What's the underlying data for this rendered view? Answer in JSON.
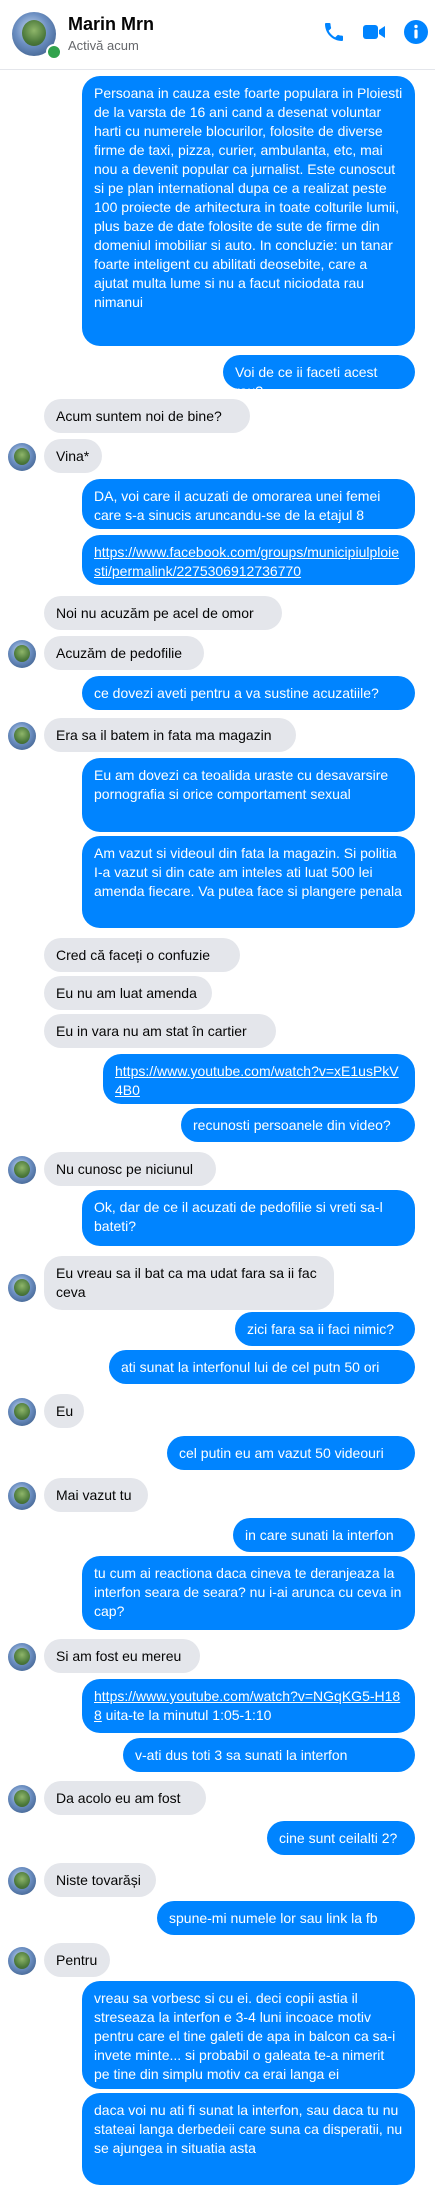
{
  "header": {
    "name": "Marin Mrn",
    "status": "Activă acum",
    "accent_color": "#0084ff",
    "icons": [
      "phone-icon",
      "video-camera-icon",
      "info-icon"
    ]
  },
  "messages": [
    {
      "dir": "out",
      "text": "Persoana in cauza este foarte populara in Ploiesti de la varsta de 16 ani cand a desenat voluntar harti cu numerele blocurilor, folosite de diverse firme de taxi, pizza, curier, ambulanta, etc, mai nou a devenit popular ca jurnalist. Este cunoscut si pe plan international dupa ce a realizat peste 100 proiecte de arhitectura in toate colturile lumii, plus baze de date folosite de sute de firme din domeniul imobiliar si auto. In concluzie: un tanar foarte inteligent cu abilitati deosebite, care a ajutat multa lume si nu a facut niciodata rau nimanui"
    },
    {
      "dir": "out",
      "text": "Voi de ce ii faceti acest rau?"
    },
    {
      "dir": "in",
      "text": "Acum suntem noi de  bine?"
    },
    {
      "dir": "in",
      "text": "Vina*"
    },
    {
      "dir": "out",
      "text": "DA, voi care il acuzati de omorarea unei femei care s-a sinucis aruncandu-se de la etajul 8"
    },
    {
      "dir": "out",
      "text": "https://www.facebook.com/groups/municipiulploiesti/permalink/2275306912736770"
    },
    {
      "dir": "in",
      "text": "Noi nu acuzăm pe acel de omor"
    },
    {
      "dir": "in",
      "text": "Acuzăm de pedofilie"
    },
    {
      "dir": "out",
      "text": "ce dovezi aveti pentru a va sustine acuzatiile?"
    },
    {
      "dir": "in",
      "text": "Era sa il batem in fata ma magazin"
    },
    {
      "dir": "out",
      "text": "Eu am dovezi ca teoalida uraste cu desavarsire pornografia si orice comportament sexual"
    },
    {
      "dir": "out",
      "text": "Am vazut si videoul din fata la magazin. Si politia I-a vazut si din cate am inteles ati luat 500 lei amenda fiecare. Va putea face si plangere penala"
    },
    {
      "dir": "in",
      "text": "Cred că faceți o confuzie"
    },
    {
      "dir": "in",
      "text": "Eu nu am luat amenda"
    },
    {
      "dir": "in",
      "text": "Eu in vara nu am stat în cartier"
    },
    {
      "dir": "out",
      "text": "https://www.youtube.com/watch?v=xE1usPkV4B0"
    },
    {
      "dir": "out",
      "text": "recunosti persoanele din video?"
    },
    {
      "dir": "in",
      "text": "Nu cunosc pe niciunul"
    },
    {
      "dir": "out",
      "text": "Ok, dar de ce il acuzati de pedofilie si vreti sa-l bateti?"
    },
    {
      "dir": "in",
      "text": "Eu vreau sa il bat ca ma udat fara sa ii fac ceva"
    },
    {
      "dir": "out",
      "text": "zici fara sa ii faci nimic?"
    },
    {
      "dir": "out",
      "text": "ati sunat la interfonul lui de cel putn 50 ori"
    },
    {
      "dir": "in",
      "text": "Eu"
    },
    {
      "dir": "out",
      "text": "cel putin eu am vazut 50 videouri"
    },
    {
      "dir": "in",
      "text": "Mai vazut tu"
    },
    {
      "dir": "out",
      "text": "in care sunati la interfon"
    },
    {
      "dir": "out",
      "text": "tu cum ai reactiona daca cineva te deranjeaza la interfon seara de seara? nu i-ai arunca cu ceva in cap?"
    },
    {
      "dir": "in",
      "text": "Si am fost eu mereu"
    },
    {
      "dir": "out",
      "link": "https://www.youtube.com/watch?v=NGqKG5-H188",
      "text": " uita-te la minutul 1:05-1:10"
    },
    {
      "dir": "out",
      "text": "v-ati dus toti 3 sa sunati la interfon"
    },
    {
      "dir": "in",
      "text": "Da  acolo eu am fost"
    },
    {
      "dir": "out",
      "text": "cine sunt ceilalti 2?"
    },
    {
      "dir": "in",
      "text": "Niste tovarăși"
    },
    {
      "dir": "out",
      "text": "spune-mi numele lor sau link la fb"
    },
    {
      "dir": "in",
      "text": "Pentru"
    },
    {
      "dir": "out",
      "text": "vreau sa vorbesc si cu ei. deci copii astia il streseaza la interfon e 3-4 luni incoace motiv pentru care el tine galeti de apa in balcon ca sa-i invete minte... si probabil o galeata te-a nimerit pe tine din simplu motiv ca erai langa ei"
    },
    {
      "dir": "out",
      "text": "daca voi nu ati fi sunat la interfon, sau daca tu nu stateai langa derbedeii care suna ca disperatii, nu se ajungea in situatia asta"
    }
  ]
}
